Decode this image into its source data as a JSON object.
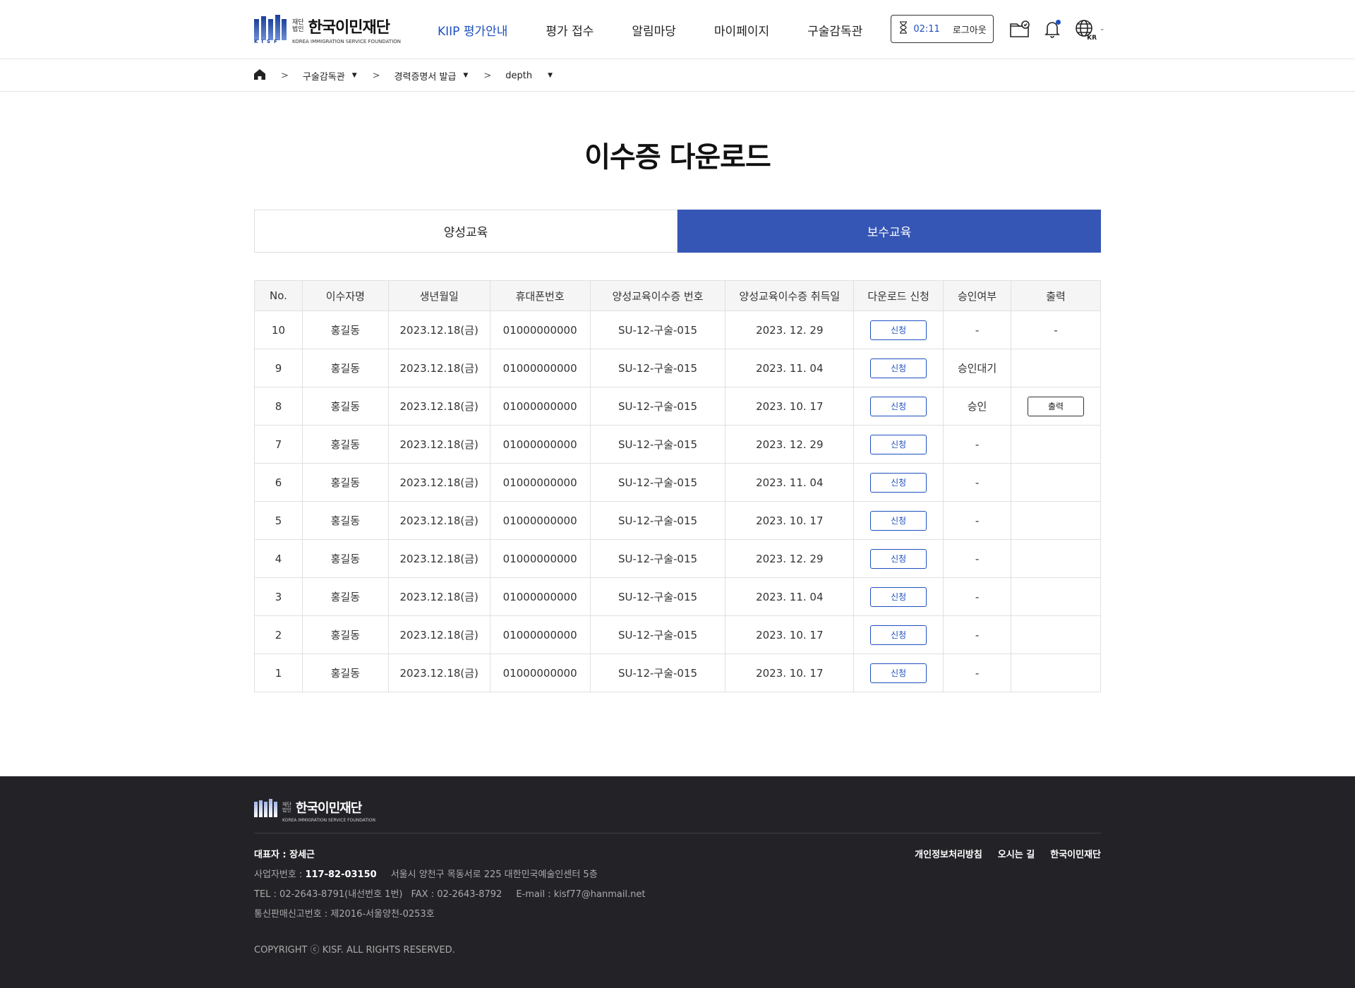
{
  "header": {
    "logo": {
      "sub1": "재단",
      "sub2": "법인",
      "name": "한국이민재단",
      "en": "KOREA IMMIGRATION SERVICE FOUNDATION",
      "mark": "KISF"
    },
    "nav": [
      "KIIP 평가안내",
      "평가 접수",
      "알림마당",
      "마이페이지",
      "구술감독관"
    ],
    "timer": "02:11",
    "logout": "로그아웃",
    "lang": "KR"
  },
  "breadcrumb": [
    "구술감독관",
    "경력증명서 발급",
    "depth"
  ],
  "title": "이수증 다운로드",
  "tabs": [
    "양성교육",
    "보수교육"
  ],
  "table": {
    "headers": [
      "No.",
      "이수자명",
      "생년월일",
      "휴대폰번호",
      "양성교육이수증 번호",
      "양성교육이수증 취득일",
      "다운로드 신청",
      "승인여부",
      "출력"
    ],
    "apply_label": "신청",
    "print_label": "출력",
    "rows": [
      {
        "no": "10",
        "name": "홍길동",
        "birth": "2023.12.18(금)",
        "phone": "01000000000",
        "cert": "SU-12-구술-015",
        "date": "2023. 12. 29",
        "status": "-",
        "print": "-"
      },
      {
        "no": "9",
        "name": "홍길동",
        "birth": "2023.12.18(금)",
        "phone": "01000000000",
        "cert": "SU-12-구술-015",
        "date": "2023. 11. 04",
        "status": "승인대기",
        "print": ""
      },
      {
        "no": "8",
        "name": "홍길동",
        "birth": "2023.12.18(금)",
        "phone": "01000000000",
        "cert": "SU-12-구술-015",
        "date": "2023. 10. 17",
        "status": "승인",
        "print": "button"
      },
      {
        "no": "7",
        "name": "홍길동",
        "birth": "2023.12.18(금)",
        "phone": "01000000000",
        "cert": "SU-12-구술-015",
        "date": "2023. 12. 29",
        "status": "-",
        "print": ""
      },
      {
        "no": "6",
        "name": "홍길동",
        "birth": "2023.12.18(금)",
        "phone": "01000000000",
        "cert": "SU-12-구술-015",
        "date": "2023. 11. 04",
        "status": "-",
        "print": ""
      },
      {
        "no": "5",
        "name": "홍길동",
        "birth": "2023.12.18(금)",
        "phone": "01000000000",
        "cert": "SU-12-구술-015",
        "date": "2023. 10. 17",
        "status": "-",
        "print": ""
      },
      {
        "no": "4",
        "name": "홍길동",
        "birth": "2023.12.18(금)",
        "phone": "01000000000",
        "cert": "SU-12-구술-015",
        "date": "2023. 12. 29",
        "status": "-",
        "print": ""
      },
      {
        "no": "3",
        "name": "홍길동",
        "birth": "2023.12.18(금)",
        "phone": "01000000000",
        "cert": "SU-12-구술-015",
        "date": "2023. 11. 04",
        "status": "-",
        "print": ""
      },
      {
        "no": "2",
        "name": "홍길동",
        "birth": "2023.12.18(금)",
        "phone": "01000000000",
        "cert": "SU-12-구술-015",
        "date": "2023. 10. 17",
        "status": "-",
        "print": ""
      },
      {
        "no": "1",
        "name": "홍길동",
        "birth": "2023.12.18(금)",
        "phone": "01000000000",
        "cert": "SU-12-구술-015",
        "date": "2023. 10. 17",
        "status": "-",
        "print": ""
      }
    ]
  },
  "footer": {
    "rep": "대표자 : 장세근",
    "biz_label": "사업자번호 : ",
    "biz_no": "117-82-03150",
    "address": "서울시 양천구 목동서로 225 대한민국예술인센터 5층",
    "tel": "TEL : 02-2643-8791(내선번호 1번)",
    "fax": "FAX : 02-2643-8792",
    "email": "E-mail : kisf77@hanmail.net",
    "mail_order": "통신판매신고번호 : 제2016-서울양천-0253호",
    "copyright": "COPYRIGHT ⓒ KISF. ALL RIGHTS RESERVED.",
    "links": [
      "개인정보처리방침",
      "오시는 길",
      "한국이민재단"
    ]
  },
  "colors": {
    "accent": "#1d4fbf",
    "tab_active": "#3656b5",
    "footer_bg": "#232327"
  }
}
